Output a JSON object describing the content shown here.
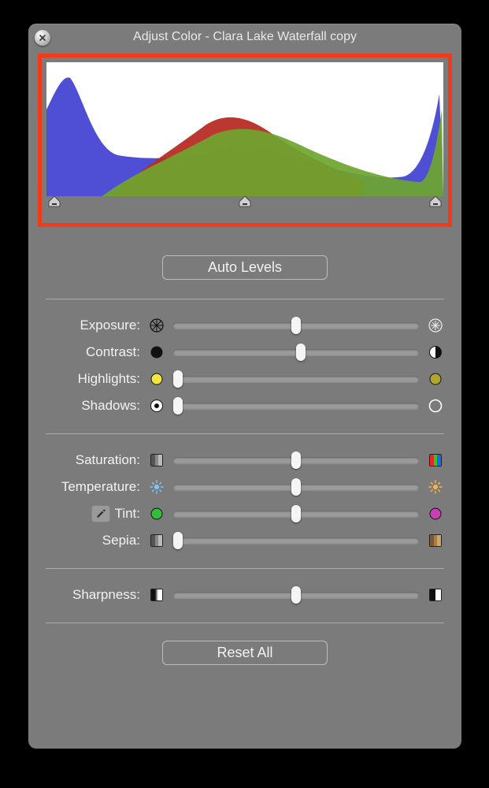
{
  "window": {
    "title": "Adjust Color - Clara Lake Waterfall copy"
  },
  "buttons": {
    "auto_levels": "Auto Levels",
    "reset_all": "Reset All"
  },
  "histogram": {
    "handles": {
      "black": 0,
      "mid": 50,
      "white": 100
    }
  },
  "sliders": {
    "exposure": {
      "label": "Exposure:",
      "value": 50,
      "min_icon": "aperture-closed-icon",
      "max_icon": "aperture-open-icon"
    },
    "contrast": {
      "label": "Contrast:",
      "value": 52,
      "min_icon": "circle-filled-icon",
      "max_icon": "circle-half-icon"
    },
    "highlights": {
      "label": "Highlights:",
      "value": 2,
      "min_icon": "dot-yellow-icon",
      "max_icon": "dot-olive-icon"
    },
    "shadows": {
      "label": "Shadows:",
      "value": 2,
      "min_icon": "ring-filled-icon",
      "max_icon": "ring-open-icon"
    },
    "saturation": {
      "label": "Saturation:",
      "value": 50,
      "min_icon": "swatch-gray-icon",
      "max_icon": "swatch-rainbow-icon"
    },
    "temperature": {
      "label": "Temperature:",
      "value": 50,
      "min_icon": "sun-cool-icon",
      "max_icon": "sun-warm-icon"
    },
    "tint": {
      "label": "Tint:",
      "value": 50,
      "min_icon": "dot-green-icon",
      "max_icon": "dot-magenta-icon",
      "has_eyedropper": true
    },
    "sepia": {
      "label": "Sepia:",
      "value": 2,
      "min_icon": "swatch-gray-icon",
      "max_icon": "swatch-sepia-icon"
    },
    "sharpness": {
      "label": "Sharpness:",
      "value": 50,
      "min_icon": "swatch-soft-icon",
      "max_icon": "swatch-sharp-icon"
    }
  },
  "colors": {
    "highlight_border": "#f03a1a",
    "panel_bg": "#7b7b7b"
  }
}
